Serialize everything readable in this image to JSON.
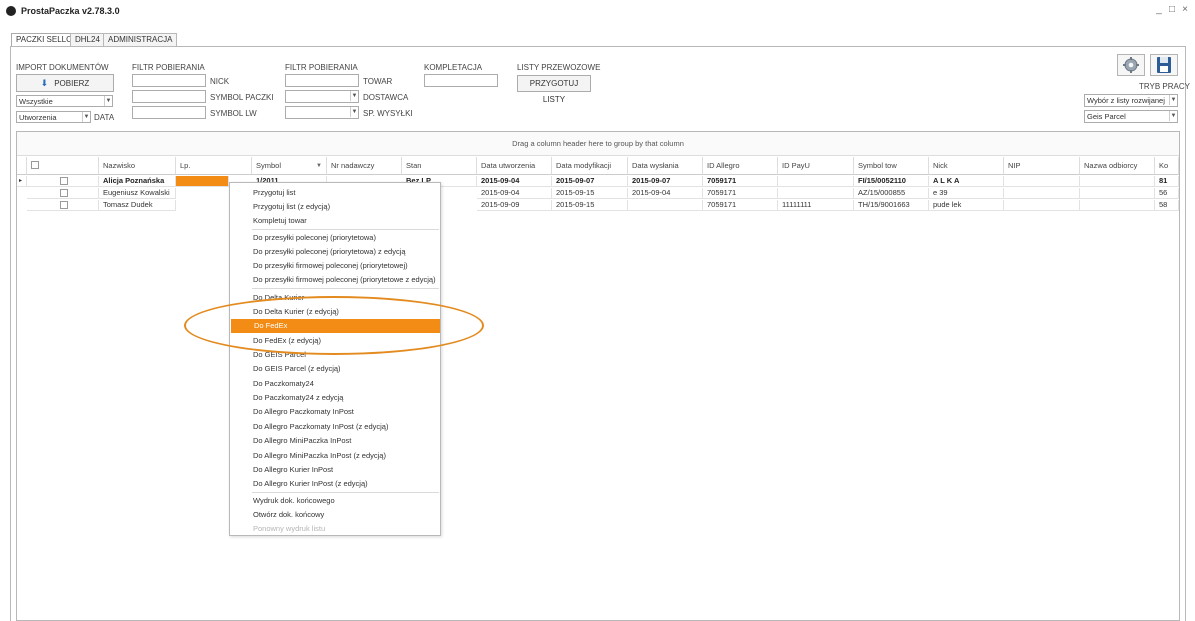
{
  "app": {
    "title": "ProstaPaczka v2.78.3.0"
  },
  "window": {
    "minimize": "_",
    "maximize": "□",
    "close": "×"
  },
  "tabs": [
    {
      "label": "PACZKI SELLO",
      "active": true
    },
    {
      "label": "DHL24",
      "active": false
    },
    {
      "label": "ADMINISTRACJA",
      "active": false
    }
  ],
  "toolbar": {
    "import": {
      "title": "IMPORT DOKUMENTÓW",
      "pobierz_label": "POBIERZ",
      "filter_value": "Wszystkie",
      "sort_value": "Utworzenia",
      "sort_label": "DATA"
    },
    "filter1": {
      "title": "FILTR POBIERANIA",
      "nick_label": "NICK",
      "symbol_paczki_label": "SYMBOL PACZKI",
      "symbol_lw_label": "SYMBOL LW"
    },
    "filter2": {
      "title": "FILTR POBIERANIA",
      "towar_label": "TOWAR",
      "dostawca_label": "DOSTAWCA",
      "sp_wysylki_label": "SP. WYSYŁKI"
    },
    "kompletacja": {
      "title": "KOMPLETACJA"
    },
    "listy": {
      "title": "LISTY PRZEWOZOWE",
      "button_label": "PRZYGOTUJ LISTY"
    },
    "tryb": {
      "title": "TRYB PRACY",
      "mode_value": "Wybór z listy rozwijanej",
      "carrier_value": "Geis Parcel"
    }
  },
  "grid": {
    "group_hint": "Drag a column header here to group by that column",
    "columns": [
      "Nazwisko",
      "Lp.",
      "Symbol",
      "Nr nadawczy",
      "Stan",
      "Data utworzenia",
      "Data modyfikacji",
      "Data wysłania",
      "ID Allegro",
      "ID PayU",
      "Symbol tow",
      "Nick",
      "NIP",
      "Nazwa odbiorcy",
      "Ko"
    ],
    "rows": [
      {
        "nazwisko": "Alicja Poznańska",
        "symbol": "1/2011",
        "stan": "Bez LP",
        "data_utw": "2015-09-04",
        "data_mod": "2015-09-07",
        "data_wys": "2015-09-07",
        "id_allegro": "7059171",
        "id_payu": "",
        "symbol_tow": "FI/15/0052110",
        "nick": "A L K A",
        "ko": "81"
      },
      {
        "nazwisko": "Eugeniusz Kowalski",
        "symbol": "",
        "stan": "",
        "data_utw": "2015-09-04",
        "data_mod": "2015-09-15",
        "data_wys": "2015-09-04",
        "id_allegro": "7059171",
        "id_payu": "",
        "symbol_tow": "AZ/15/000855",
        "nick": "e 39",
        "ko": "56"
      },
      {
        "nazwisko": "Tomasz Dudek",
        "symbol": "",
        "stan": "",
        "data_utw": "2015-09-09",
        "data_mod": "2015-09-15",
        "data_wys": "",
        "id_allegro": "7059171",
        "id_payu": "11111111",
        "symbol_tow": "TH/15/9001663",
        "nick": "pude lek",
        "ko": "58"
      }
    ]
  },
  "menu": {
    "items": [
      "Przygotuj list",
      "Przygotuj list (z edycją)",
      "Kompletuj towar",
      "Do przesyłki poleconej (priorytetowa)",
      "Do przesyłki poleconej (priorytetowa) z edycją",
      "Do przesyłki firmowej poleconej (priorytetowej)",
      "Do przesyłki firmowej poleconej (priorytetowe z edycją)",
      "Do Delta Kurier",
      "Do Delta Kurier (z edycją)",
      "Do FedEx",
      "Do FedEx (z edycją)",
      "Do GEIS Parcel",
      "Do GEIS Parcel (z edycją)",
      "Do Paczkomaty24",
      "Do Paczkomaty24 z edycją",
      "Do Allegro Paczkomaty InPost",
      "Do Allegro Paczkomaty InPost (z edycją)",
      "Do Allegro MiniPaczka InPost",
      "Do Allegro MiniPaczka InPost (z edycją)",
      "Do Allegro Kurier InPost",
      "Do Allegro Kurier InPost (z edycją)",
      "Wydruk dok. końcowego",
      "Otwórz dok. końcowy",
      "Ponowny wydruk listu"
    ],
    "highlighted": "Do FedEx",
    "disabled": "Ponowny wydruk listu"
  },
  "colors": {
    "highlight": "#f28c14",
    "ellipse": "#e38b1f"
  }
}
